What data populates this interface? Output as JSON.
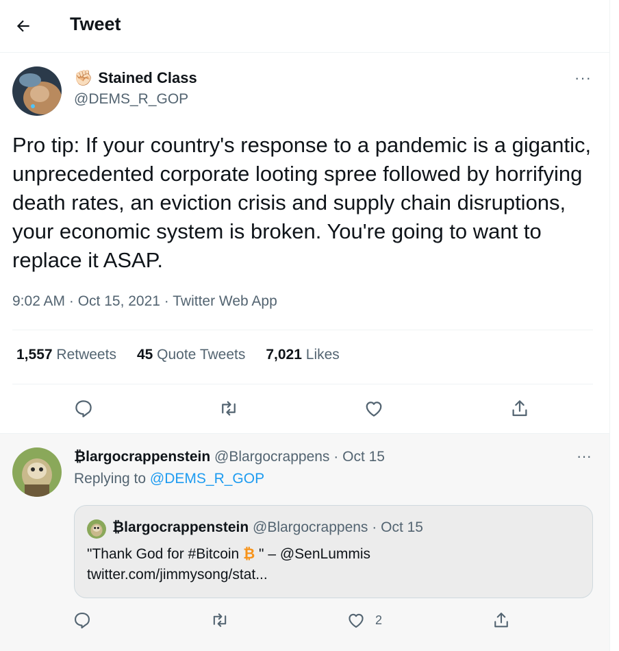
{
  "header": {
    "title": "Tweet",
    "back_icon": "arrow-left-icon"
  },
  "tweet": {
    "author": {
      "display_name": "Stained Class",
      "handle": "@DEMS_R_GOP",
      "name_emoji": "✊🏻"
    },
    "text": "Pro tip: If your country's response to a pandemic is a gigantic, unprecedented corporate looting spree followed by horrifying death rates, an eviction crisis and supply chain disruptions, your economic system is broken. You're going to want to replace it ASAP.",
    "meta": "9:02 AM · Oct 15, 2021 · Twitter Web App",
    "more": "···",
    "stats": [
      {
        "value": "1,557",
        "label": "Retweets"
      },
      {
        "value": "45",
        "label": "Quote Tweets"
      },
      {
        "value": "7,021",
        "label": "Likes"
      }
    ]
  },
  "reply": {
    "display_name": "₿largocrappenstein",
    "handle": "@Blargocrappens",
    "date": "· Oct 15",
    "more": "···",
    "replying_prefix": "Replying to",
    "replying_to": "@DEMS_R_GOP",
    "like_count": "2",
    "quote": {
      "display_name": "₿largocrappenstein",
      "handle": "@Blargocrappens",
      "date": "· Oct 15",
      "text_before": "\"Thank God for #Bitcoin ",
      "btc_symbol": "₿",
      "text_after": " \" – @SenLummis",
      "link": "twitter.com/jimmysong/stat..."
    }
  },
  "colors": {
    "link": "#1d9bf0",
    "muted": "#536471",
    "text": "#0f1419",
    "bitcoin": "#f7931a"
  }
}
